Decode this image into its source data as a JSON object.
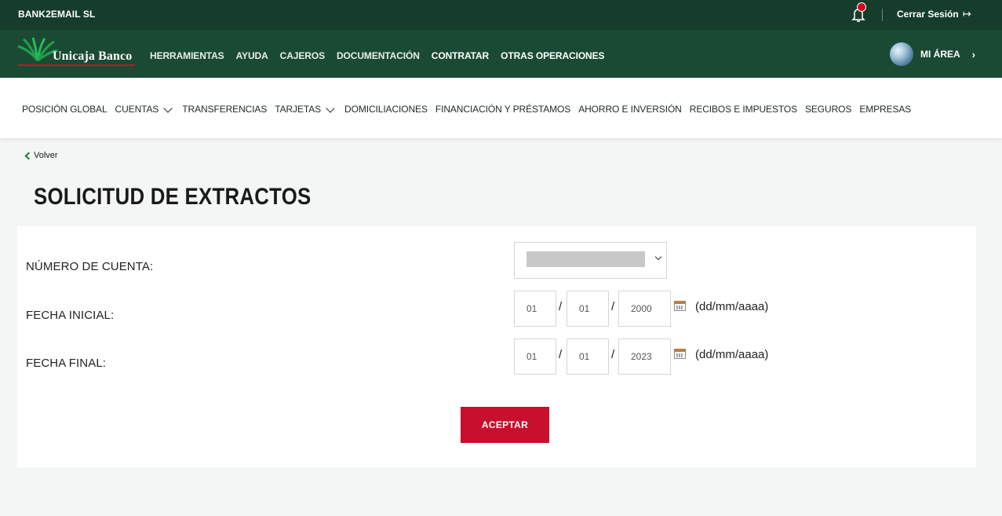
{
  "topbar": {
    "company": "BANK2EMAIL SL",
    "logout_label": "Cerrar Sesión",
    "logout_icon": "↦"
  },
  "brand": {
    "name": "Unicaja Banco",
    "primary_color": "#1b4a34",
    "accent_color": "#c8102e"
  },
  "mainnav": {
    "items": [
      "HERRAMIENTAS",
      "AYUDA",
      "CAJEROS",
      "DOCUMENTACIÓN",
      "CONTRATAR",
      "OTRAS OPERACIONES"
    ],
    "area_label": "MI ÁREA",
    "area_chevron": "›"
  },
  "subnav": {
    "items": [
      "POSICIÓN GLOBAL",
      "CUENTAS",
      "TRANSFERENCIAS",
      "TARJETAS",
      "DOMICILIACIONES",
      "FINANCIACIÓN Y PRÉSTAMOS",
      "AHORRO E INVERSIÓN",
      "RECIBOS E IMPUESTOS",
      "SEGUROS",
      "EMPRESAS"
    ]
  },
  "back_label": "Volver",
  "page_title": "SOLICITUD DE EXTRACTOS",
  "form": {
    "account_label": "NÚMERO DE CUENTA:",
    "start_label": "FECHA INICIAL:",
    "end_label": "FECHA FINAL:",
    "start": {
      "day": "01",
      "month": "01",
      "year": "2000"
    },
    "end": {
      "day": "01",
      "month": "01",
      "year": "2023"
    },
    "separator": "/",
    "format_hint": "(dd/mm/aaaa)",
    "submit_label": "ACEPTAR"
  }
}
